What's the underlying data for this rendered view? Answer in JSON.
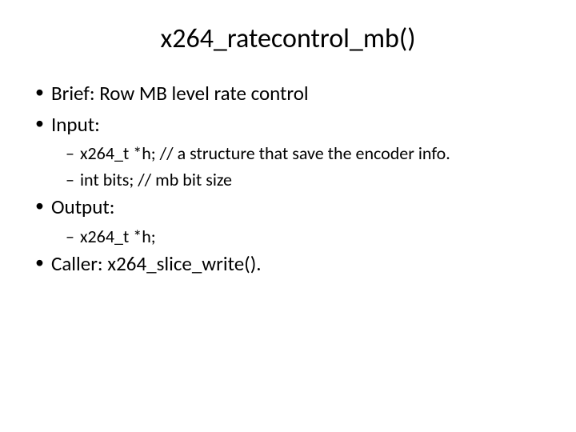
{
  "title": "x264_ratecontrol_mb()",
  "bullets": {
    "brief": "Brief: Row MB level rate control",
    "input_label": "Input:",
    "input_1": "x264_t *h; // a structure that save the encoder info.",
    "input_2": "int bits; // mb bit size",
    "output_label": "Output:",
    "output_1": "x264_t *h;",
    "caller": "Caller: x264_slice_write()."
  }
}
